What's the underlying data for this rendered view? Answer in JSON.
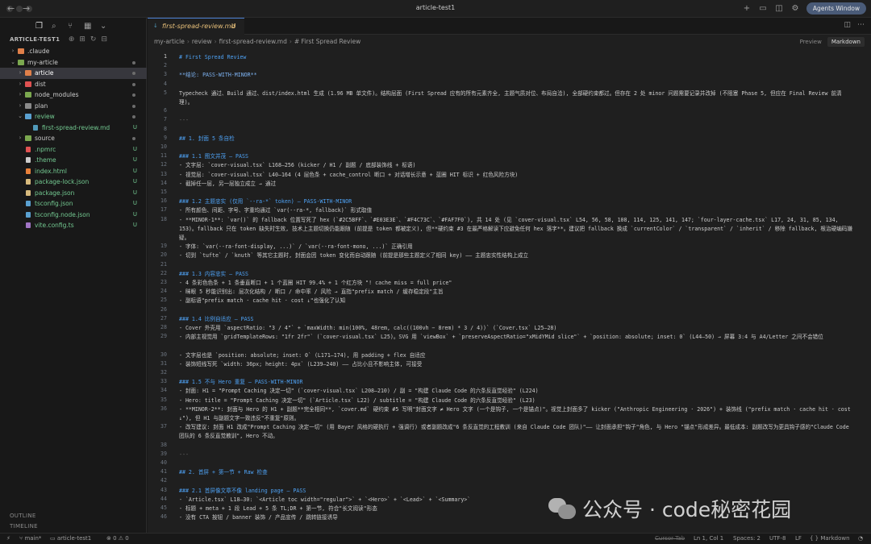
{
  "window": {
    "title": "article-test1",
    "agents_button": "Agents Window",
    "nav_back": "←",
    "nav_forward": "→"
  },
  "icons": {
    "files": "files-icon",
    "search": "search-icon",
    "source_control": "source-control-icon",
    "extensions": "extensions-icon",
    "more": "chevron-down-icon"
  },
  "explorer": {
    "header": "ARTICLE-TEST1",
    "items": [
      {
        "label": "_claude",
        "display": ".claude",
        "indent": 0,
        "type": "folder",
        "chev": "›",
        "color": "#e0804a"
      },
      {
        "label": "my-article",
        "display": "my-article",
        "indent": 0,
        "type": "folder-open",
        "chev": "⌄",
        "color": "#7ba84f",
        "dot": true
      },
      {
        "label": "article",
        "display": "article",
        "indent": 1,
        "type": "folder",
        "chev": "›",
        "color": "#e0804a",
        "selected": true,
        "dot": true
      },
      {
        "label": "dist",
        "display": "dist",
        "indent": 1,
        "type": "folder",
        "chev": "›",
        "color": "#e05252",
        "dot": true
      },
      {
        "label": "node_modules",
        "display": "node_modules",
        "indent": 1,
        "type": "folder",
        "chev": "›",
        "color": "#7ba84f",
        "dot": true
      },
      {
        "label": "plan",
        "display": "plan",
        "indent": 1,
        "type": "folder",
        "chev": "›",
        "color": "#8a8a8a",
        "dot": true
      },
      {
        "label": "review",
        "display": "review",
        "indent": 1,
        "type": "folder-open",
        "chev": "⌄",
        "color": "#5aa0d0",
        "dot": true,
        "green": true
      },
      {
        "label": "first-spread-review.md",
        "display": "first-spread-review.md",
        "indent": 2,
        "type": "md",
        "color": "#519aba",
        "status": "U",
        "green": true
      },
      {
        "label": "source",
        "display": "source",
        "indent": 1,
        "type": "folder",
        "chev": "›",
        "color": "#7ba84f",
        "dot": true
      },
      {
        "label": "_npmrc",
        "display": ".npmrc",
        "indent": 1,
        "type": "file",
        "color": "#e05252",
        "status": "U",
        "green": true
      },
      {
        "label": "_theme",
        "display": ".theme",
        "indent": 1,
        "type": "file",
        "color": "#cccccc",
        "status": "U",
        "green": true
      },
      {
        "label": "index.html",
        "display": "index.html",
        "indent": 1,
        "type": "file",
        "color": "#e8803a",
        "status": "U",
        "green": true
      },
      {
        "label": "package-lock.json",
        "display": "package-lock.json",
        "indent": 1,
        "type": "file",
        "color": "#d7ba7d",
        "status": "U",
        "green": true
      },
      {
        "label": "package.json",
        "display": "package.json",
        "indent": 1,
        "type": "file",
        "color": "#d7ba7d",
        "status": "U",
        "green": true
      },
      {
        "label": "tsconfig.json",
        "display": "tsconfig.json",
        "indent": 1,
        "type": "file",
        "color": "#5aa0d0",
        "status": "U",
        "green": true
      },
      {
        "label": "tsconfig.node.json",
        "display": "tsconfig.node.json",
        "indent": 1,
        "type": "file",
        "color": "#5aa0d0",
        "status": "U",
        "green": true
      },
      {
        "label": "vite.config.ts",
        "display": "vite.config.ts",
        "indent": 1,
        "type": "file",
        "color": "#a074c4",
        "status": "U",
        "green": true
      }
    ],
    "outline": "OUTLINE",
    "timeline": "TIMELINE"
  },
  "tab": {
    "filename": "first-spread-review.md",
    "status": "U",
    "icon": "↓"
  },
  "breadcrumb": [
    "my-article",
    "review",
    "first-spread-review.md",
    "# First Spread Review"
  ],
  "view_toggle": {
    "preview": "Preview",
    "markdown": "Markdown"
  },
  "lines": [
    {
      "n": "1",
      "t": "# First Spread Review",
      "k": "h",
      "cur": true
    },
    {
      "n": "2",
      "t": ""
    },
    {
      "n": "3",
      "t": "**结论: PASS-WITH-MINOR**",
      "k": "bold"
    },
    {
      "n": "4",
      "t": ""
    },
    {
      "n": "5",
      "t": "Typecheck 通过、Build 通过、dist/index.html 生成 (1.96 MB 单文件)。结构层面 (First Spread 应有的所有元素齐全, 主题气质对位、布局自洽), 全部硬约束都过。但存在 2 处 minor 问题需要记录并改掉 (不阻塞 Phase 5, 但应在 Final Review 前清理)。",
      "wrap": 2
    },
    {
      "n": "6",
      "t": ""
    },
    {
      "n": "7",
      "t": "---",
      "k": "hr"
    },
    {
      "n": "8",
      "t": ""
    },
    {
      "n": "9",
      "t": "## 1. 封面 5 条自检",
      "k": "h"
    },
    {
      "n": "10",
      "t": ""
    },
    {
      "n": "11",
      "t": "### 1.1 图文并茂 — PASS",
      "k": "h"
    },
    {
      "n": "12",
      "t": "- 文字层: `cover-visual.tsx` L168–256 (kicker / H1 / 副题 / 底部装饰线 + 标语)"
    },
    {
      "n": "13",
      "t": "- 视觉层: `cover-visual.tsx` L40–164 (4 层色条 + cache_control 断口 + 对话增长示意 + 蓝圈 HIT 标识 + 红色风险方块)"
    },
    {
      "n": "14",
      "t": "- 截掉任一层, 另一层独立成立 → 通过"
    },
    {
      "n": "15",
      "t": ""
    },
    {
      "n": "16",
      "t": "### 1.2 主题忠实 (仅用 `--ra-*` token) — PASS-WITH-MINOR",
      "k": "h"
    },
    {
      "n": "17",
      "t": "- 所有颜色、间距、字号、字重均通过 `var(--ra-*, fallback)` 形式取值"
    },
    {
      "n": "18",
      "t": "- **MINOR-1**: `var()` 的 fallback 位置写死了 hex (`#2C5BFF`、`#E03E3E`、`#F4C73C`、`#FAF7F0`), 共 14 处 (见 `cover-visual.tsx` L54, 56, 58, 108, 114, 125, 141, 147; `four-layer-cache.tsx` L17, 24, 31, 85, 134, 153)。fallback 只在 token 缺失时生效, 技术上主题切换仍能跟随 (前提是 token 都被定义), 但**硬约束 #3 在最严格解读下应避免任何 hex 落字**。建议把 fallback 换成 `currentColor` / `transparent` / `inherit` / 移除 fallback, 根治硬编码嫌疑。",
      "wrap": 3
    },
    {
      "n": "19",
      "t": "- 字体: `var(--ra-font-display, ...)` / `var(--ra-font-mono, ...)` 正确引用"
    },
    {
      "n": "20",
      "t": "- 切到 `tufte` / `knuth` 等其它主题时, 封面会因 token 变化而自动跟随 (前提是那些主题定义了相同 key) —— 主题忠实性结构上成立"
    },
    {
      "n": "21",
      "t": ""
    },
    {
      "n": "22",
      "t": "### 1.3 内容忠实 — PASS",
      "k": "h"
    },
    {
      "n": "23",
      "t": "- 4 条彩色色条 + 1 条垂直断口 + 1 个蓝圈 HIT 99.4% + 1 个红方块 \"! cache miss = full price\""
    },
    {
      "n": "24",
      "t": "- 眯眼 5 秒能识别出: 层次化结构 / 断口 / 命中率 / 风险 → 直指\"prefix match / 缓存稳定段\"主旨"
    },
    {
      "n": "25",
      "t": "- 副标语\"prefix match · cache hit · cost ↓\"也强化了认知"
    },
    {
      "n": "26",
      "t": ""
    },
    {
      "n": "27",
      "t": "### 1.4 比例自适应 — PASS",
      "k": "h"
    },
    {
      "n": "28",
      "t": "- Cover 外壳用 `aspectRatio: \"3 / 4\"` + `maxWidth: min(100%, 48rem, calc((100vh − 8rem) * 3 / 4))` (`Cover.tsx` L25–28)"
    },
    {
      "n": "29",
      "t": "- 内部主视觉用 `gridTemplateRows: \"1fr 2fr\"` (`cover-visual.tsx` L25)。SVG 用 `viewBox` + `preserveAspectRatio=\"xMidYMid slice\"` + `position: absolute; inset: 0` (L44–50) → 屏幕 3:4 与 A4/Letter 之间不会错位",
      "wrap": 2
    },
    {
      "n": "30",
      "t": "- 文字层也是 `position: absolute; inset: 0` (L171–174), 用 padding + flex 自适应"
    },
    {
      "n": "31",
      "t": "- 装饰短线写死 `width: 36px; height: 4px` (L239–240) —— 占比小且不影响主体, 可接受"
    },
    {
      "n": "32",
      "t": ""
    },
    {
      "n": "33",
      "t": "### 1.5 不与 Hero 重复 — PASS-WITH-MINOR",
      "k": "h"
    },
    {
      "n": "34",
      "t": "- 封面: H1 = \"Prompt Caching 决定一切\" (`cover-visual.tsx` L208–210) / 副 = \"构建 Claude Code 的六条反直觉经验\" (L224)"
    },
    {
      "n": "35",
      "t": "- Hero: title = \"Prompt Caching 决定一切\" (`Article.tsx` L22) / subtitle = \"构建 Claude Code 的六条反直觉经验\" (L23)"
    },
    {
      "n": "36",
      "t": "- **MINOR-2**: 封面与 Hero 的 H1 + 副题**完全相同**, `cover.md` 硬约束 #5 写明\"封面文字 ≠ Hero 文字 (一个是钩子, 一个是锚点)\"。视觉上封面多了 kicker (\"Anthropic Engineering · 2026\") + 装饰线 (\"prefix match · cache hit · cost ↓\"), 但 H1 与副题文字一致违反\"不重复\"原则。",
      "wrap": 2
    },
    {
      "n": "37",
      "t": "- 改写建议: 封面 H1 改成\"Prompt Caching 决定一切\" (用 Bayer 风格的硬执行 + 强调行) 或者副题改成\"6 条反直觉的工程教训 (来自 Claude Code 团队)\"—— 让封面承担\"钩子\"角色, 与 Hero \"锚点\"形成差异。最低成本: 副题改写为更具钩子感的\"Claude Code 团队的 6 条反直觉教训\", Hero 不动。",
      "wrap": 2
    },
    {
      "n": "38",
      "t": ""
    },
    {
      "n": "39",
      "t": "---",
      "k": "hr"
    },
    {
      "n": "40",
      "t": ""
    },
    {
      "n": "41",
      "t": "## 2. 首屏 + 第一节 + Raw 检查",
      "k": "h"
    },
    {
      "n": "42",
      "t": ""
    },
    {
      "n": "43",
      "t": "### 2.1 首屏像文章不像 landing page — PASS",
      "k": "h"
    },
    {
      "n": "44",
      "t": "- `Article.tsx` L18–30: `<Article toc width=\"regular\">` + `<Hero>` + `<Lead>` + `<Summary>`"
    },
    {
      "n": "45",
      "t": "- 标题 + meta + 1 段 Lead + 5 条 TL;DR + 第一节, 符合\"长文阅读\"形态"
    },
    {
      "n": "46",
      "t": "- 没有 CTA 按钮 / banner 装饰 / 产品宣传 / 跳转链接诱导"
    }
  ],
  "status": {
    "branch": "main*",
    "folder": "article-test1",
    "errors": "0",
    "warnings": "0",
    "cursor_tab": "Cursor Tab",
    "position": "Ln 1, Col 1",
    "spaces": "Spaces: 2",
    "encoding": "UTF-8",
    "eol": "LF",
    "language": "Markdown"
  },
  "watermark": {
    "text": "公众号 · code秘密花园"
  },
  "colors": {
    "accent": "#4a7fd1",
    "untracked": "#73c991",
    "modified_tab": "#e8c07a",
    "heading": "#4ea1f3"
  }
}
